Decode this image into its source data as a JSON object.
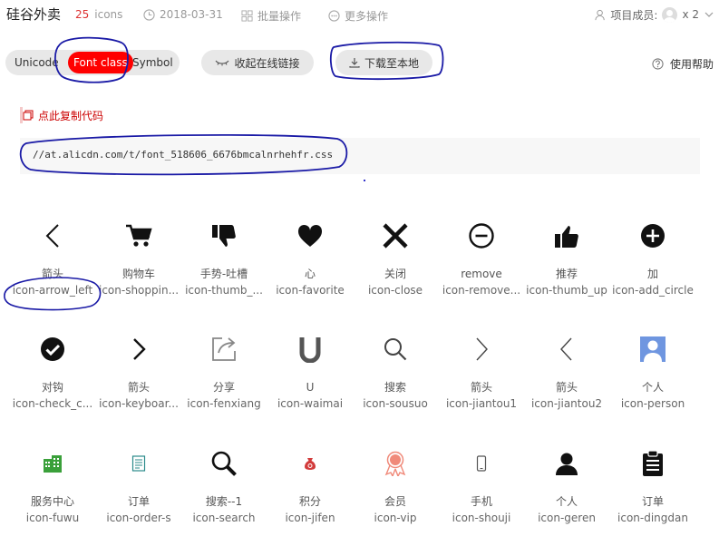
{
  "header": {
    "title": "硅谷外卖",
    "icon_count": "25",
    "icon_count_unit": "icons",
    "date": "2018-03-31",
    "batch_ops": "批量操作",
    "more_ops": "更多操作",
    "members_label": "项目成员:",
    "members_count": "x 2"
  },
  "toolbar": {
    "tabs": [
      "Unicode",
      "Font class",
      "Symbol"
    ],
    "active_tab": "Font class",
    "online_link": "收起在线链接",
    "download": "下载至本地",
    "help": "使用帮助"
  },
  "code": {
    "copy_label": "点此复制代码",
    "url": "//at.alicdn.com/t/font_518606_6676bmcalnrhehfr.css"
  },
  "colors": {
    "accent_red": "#ff0000",
    "annotation_blue": "#1a1aa6",
    "icon_green": "#3aa03a",
    "icon_teal": "#2a8a8a",
    "icon_person_blue": "#6f96e0",
    "icon_jifen_red": "#d23b3b",
    "icon_vip_salmon": "#f08a7a"
  },
  "icons": [
    {
      "name": "箭头",
      "class": "icon-arrow_left",
      "glyph": "arrow-left-icon"
    },
    {
      "name": "购物车",
      "class": "icon-shoppin...",
      "glyph": "shopping-cart-icon"
    },
    {
      "name": "手势-吐槽",
      "class": "icon-thumb_...",
      "glyph": "thumb-down-icon"
    },
    {
      "name": "心",
      "class": "icon-favorite",
      "glyph": "heart-icon"
    },
    {
      "name": "关闭",
      "class": "icon-close",
      "glyph": "close-icon"
    },
    {
      "name": "remove",
      "class": "icon-remove...",
      "glyph": "remove-circle-icon"
    },
    {
      "name": "推荐",
      "class": "icon-thumb_up",
      "glyph": "thumb-up-icon"
    },
    {
      "name": "加",
      "class": "icon-add_circle",
      "glyph": "add-circle-icon"
    },
    {
      "name": "对钩",
      "class": "icon-check_c...",
      "glyph": "check-circle-icon"
    },
    {
      "name": "箭头",
      "class": "icon-keyboar...",
      "glyph": "chevron-right-icon"
    },
    {
      "name": "分享",
      "class": "icon-fenxiang",
      "glyph": "share-icon"
    },
    {
      "name": "U",
      "class": "icon-waimai",
      "glyph": "u-letter-icon"
    },
    {
      "name": "搜索",
      "class": "icon-sousuo",
      "glyph": "search-icon"
    },
    {
      "name": "箭头",
      "class": "icon-jiantou1",
      "glyph": "chevron-right-thin-icon"
    },
    {
      "name": "箭头",
      "class": "icon-jiantou2",
      "glyph": "chevron-left-thin-icon"
    },
    {
      "name": "个人",
      "class": "icon-person",
      "glyph": "person-blue-icon"
    },
    {
      "name": "服务中心",
      "class": "icon-fuwu",
      "glyph": "building-icon"
    },
    {
      "name": "订单",
      "class": "icon-order-s",
      "glyph": "order-doc-icon"
    },
    {
      "name": "搜索--1",
      "class": "icon-search",
      "glyph": "search-bold-icon"
    },
    {
      "name": "积分",
      "class": "icon-jifen",
      "glyph": "points-bag-icon"
    },
    {
      "name": "会员",
      "class": "icon-vip",
      "glyph": "vip-badge-icon"
    },
    {
      "name": "手机",
      "class": "icon-shouji",
      "glyph": "phone-icon"
    },
    {
      "name": "个人",
      "class": "icon-geren",
      "glyph": "person-icon"
    },
    {
      "name": "订单",
      "class": "icon-dingdan",
      "glyph": "clipboard-icon"
    }
  ]
}
